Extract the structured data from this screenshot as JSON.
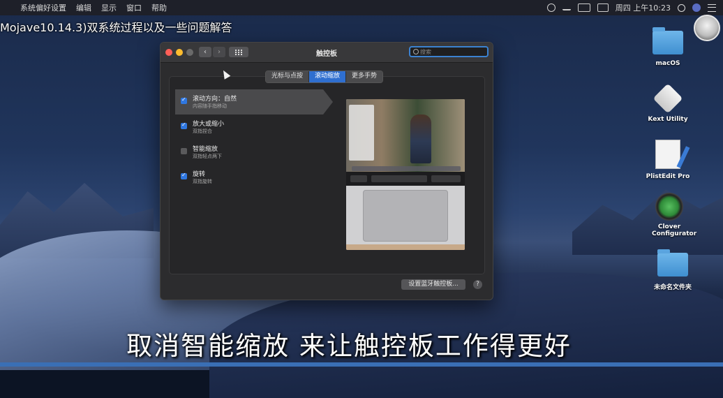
{
  "menubar": {
    "apple": "",
    "items": [
      "系统偏好设置",
      "编辑",
      "显示",
      "窗口",
      "帮助"
    ],
    "clock": "周四 上午10:23"
  },
  "overlay": {
    "video_title": "Mojave10.14.3)双系统过程以及一些问题解答",
    "subtitle": "取消智能缩放 来让触控板工作得更好"
  },
  "desktop_icons": [
    {
      "label": "macOS",
      "icon": "folder-icon"
    },
    {
      "label": "Kext Utility",
      "icon": "kext-utility-icon"
    },
    {
      "label": "PlistEdit Pro",
      "icon": "plistedit-icon"
    },
    {
      "label": "Clover Configurator",
      "icon": "clover-icon"
    },
    {
      "label": "未命名文件夹",
      "icon": "folder-icon"
    }
  ],
  "window": {
    "title": "触控板",
    "nav_back": "‹",
    "nav_forward": "›",
    "search_placeholder": "搜索",
    "tabs": [
      {
        "label": "光标与点按",
        "active": false
      },
      {
        "label": "滚动缩放",
        "active": true
      },
      {
        "label": "更多手势",
        "active": false
      }
    ],
    "options": [
      {
        "title": "滚动方向：自然",
        "desc": "内容随手指移动",
        "checked": true,
        "selected": true
      },
      {
        "title": "放大或缩小",
        "desc": "双指捏合",
        "checked": true,
        "selected": false
      },
      {
        "title": "智能缩放",
        "desc": "双指轻点两下",
        "checked": false,
        "selected": false
      },
      {
        "title": "旋转",
        "desc": "双指旋转",
        "checked": true,
        "selected": false
      }
    ],
    "bluetooth_button": "设置蓝牙触控板...",
    "help": "?"
  },
  "colors": {
    "accent": "#2f6fd0",
    "window_bg": "#2c2c2e",
    "close": "#ff5f57",
    "minimize": "#febc2e"
  }
}
